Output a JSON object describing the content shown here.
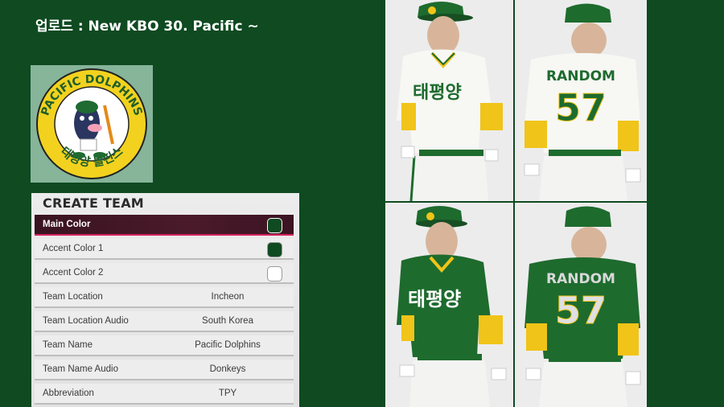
{
  "header": {
    "title": "업로드 : New KBO 30. Pacific ~"
  },
  "logo": {
    "arc_top": "PACIFIC DOLPHINS",
    "arc_bottom": "태평양 돌핀스",
    "icon": "dolphin-mascot-logo"
  },
  "panel": {
    "title": "CREATE TEAM",
    "rows": [
      {
        "label": "Main Color",
        "value": "",
        "swatch": "#0f4a21",
        "selected": true
      },
      {
        "label": "Accent Color 1",
        "value": "",
        "swatch": "#0f4a21",
        "selected": false
      },
      {
        "label": "Accent Color 2",
        "value": "",
        "swatch": "#ffffff",
        "selected": false
      },
      {
        "label": "Team Location",
        "value": "Incheon"
      },
      {
        "label": "Team Location Audio",
        "value": "South Korea"
      },
      {
        "label": "Team Name",
        "value": "Pacific Dolphins"
      },
      {
        "label": "Team Name Audio",
        "value": "Donkeys"
      },
      {
        "label": "Abbreviation",
        "value": "TPY"
      }
    ]
  },
  "uniforms": {
    "home_front_script": "태평양",
    "home_back_name": "RANDOM",
    "home_back_number": "57",
    "away_front_script": "태평양",
    "away_back_name": "RANDOM",
    "away_back_number": "57"
  },
  "colors": {
    "background": "#0f4a21",
    "team_green": "#1e6b2e",
    "team_yellow": "#f0c419",
    "selected_row": "#3a1320",
    "accent_pink": "#e0206a"
  }
}
